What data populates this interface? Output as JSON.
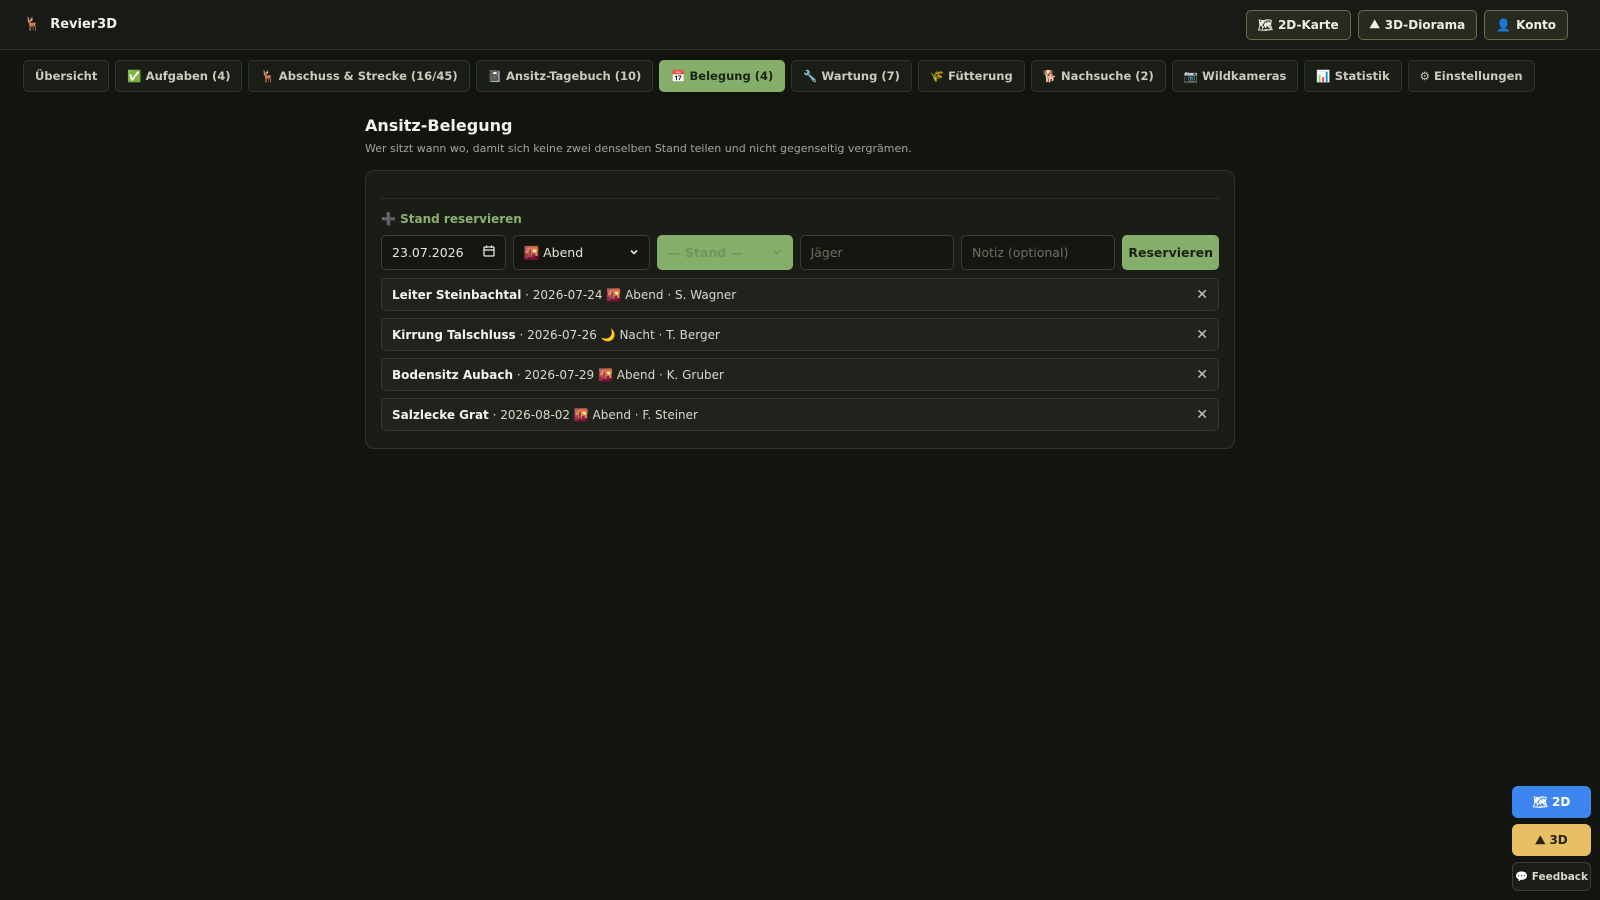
{
  "app": {
    "title": "Revier3D",
    "icon": "🦌"
  },
  "top_actions": [
    {
      "icon": "🗺",
      "label": "2D-Karte"
    },
    {
      "icon": "⛰",
      "label": "3D-Diorama"
    },
    {
      "icon": "👤",
      "label": "Konto"
    }
  ],
  "tabs": [
    {
      "label": "Übersicht"
    },
    {
      "label": "✅ Aufgaben (4)"
    },
    {
      "label": "🦌 Abschuss & Strecke (16/45)"
    },
    {
      "label": "📓 Ansitz-Tagebuch (10)"
    },
    {
      "label": "📅 Belegung (4)",
      "active": true
    },
    {
      "label": "🔧 Wartung (7)"
    },
    {
      "label": "🌾 Fütterung"
    },
    {
      "label": "🐕 Nachsuche (2)"
    },
    {
      "label": "📷 Wildkameras"
    },
    {
      "label": "📊 Statistik"
    },
    {
      "label": "⚙ Einstellungen"
    }
  ],
  "page": {
    "title": "Ansitz-Belegung",
    "subtitle": "Wer sitzt wann wo, damit sich keine zwei denselben Stand teilen und nicht gegenseitig vergrämen."
  },
  "form": {
    "section_label": "➕ Stand reservieren",
    "date_value": "23.07.2026",
    "slot_value": "🌇 Abend",
    "stand_value": "— Stand —",
    "hunter_placeholder": "Jäger",
    "note_placeholder": "Notiz (optional)",
    "submit_label": "Reservieren"
  },
  "reservations": [
    {
      "stand": "Leiter Steinbachtal",
      "details": " · 2026-07-24 🌇 Abend · S. Wagner"
    },
    {
      "stand": "Kirrung Talschluss",
      "details": " · 2026-07-26 🌙 Nacht · T. Berger"
    },
    {
      "stand": "Bodensitz Aubach",
      "details": " · 2026-07-29 🌇 Abend · K. Gruber"
    },
    {
      "stand": "Salzlecke Grat",
      "details": " · 2026-08-02 🌇 Abend · F. Steiner"
    }
  ],
  "fabs": {
    "two_d": "🗺 2D",
    "three_d": "⛰ 3D",
    "feedback": "💬 Feedback"
  },
  "colors": {
    "accent": "#86ae6b",
    "blue": "#3d86f0",
    "gold": "#e7c064",
    "background": "#12140f"
  }
}
